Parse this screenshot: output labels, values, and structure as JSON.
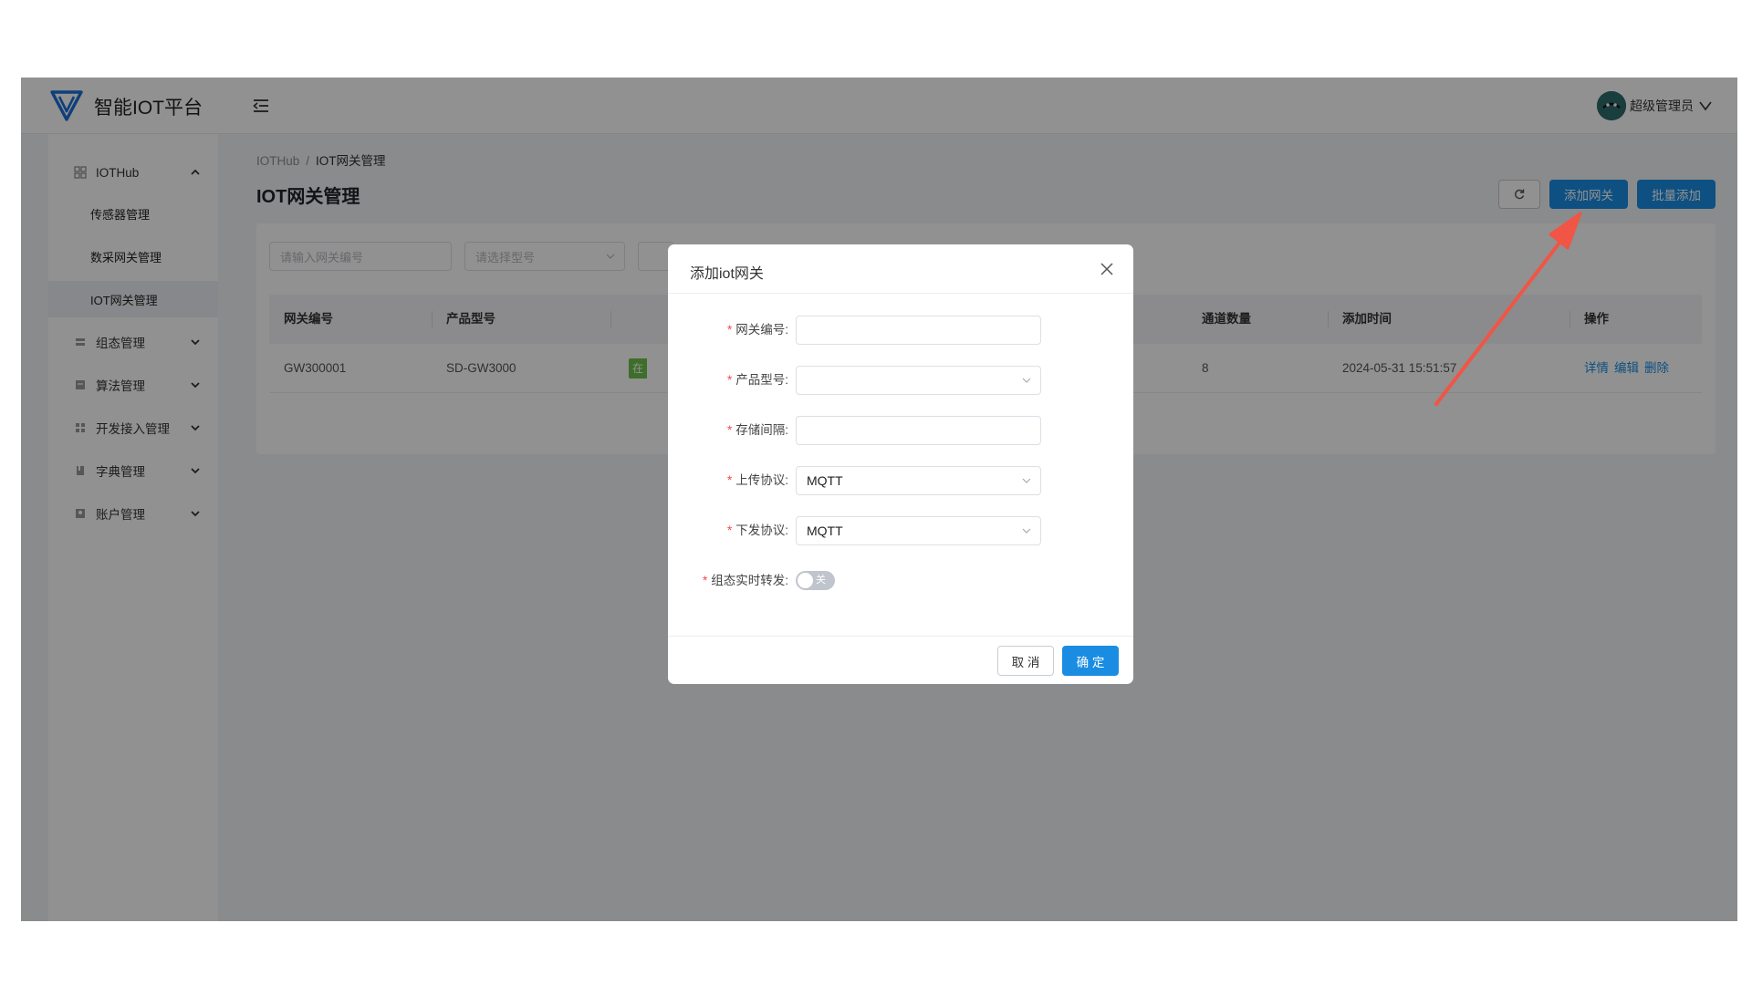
{
  "app": {
    "title": "智能IOT平台"
  },
  "user": {
    "name": "超级管理员"
  },
  "sidebar": {
    "groups": [
      {
        "label": "IOTHub",
        "icon": "grid-icon"
      },
      {
        "label": "组态管理",
        "icon": "layers-icon"
      },
      {
        "label": "算法管理",
        "icon": "list-icon"
      },
      {
        "label": "开发接入管理",
        "icon": "apps-icon"
      },
      {
        "label": "字典管理",
        "icon": "book-icon"
      },
      {
        "label": "账户管理",
        "icon": "user-card-icon"
      }
    ],
    "subitems": [
      {
        "label": "传感器管理"
      },
      {
        "label": "数采网关管理"
      },
      {
        "label": "IOT网关管理"
      }
    ]
  },
  "breadcrumb": {
    "parent": "IOTHub",
    "sep": "/",
    "current": "IOT网关管理"
  },
  "page": {
    "title": "IOT网关管理"
  },
  "toolbar": {
    "add_label": "添加网关",
    "batch_add_label": "批量添加"
  },
  "filters": {
    "gateway_placeholder": "请输入网关编号",
    "model_placeholder": "请选择型号"
  },
  "table": {
    "columns": [
      "网关编号",
      "产品型号",
      "通道数量",
      "添加时间",
      "操作"
    ],
    "rows": [
      {
        "gateway_no": "GW300001",
        "model": "SD-GW3000",
        "status": "在",
        "channels": "8",
        "added": "2024-05-31 15:51:57",
        "actions": [
          "详情",
          "编辑",
          "删除"
        ]
      }
    ]
  },
  "modal": {
    "title": "添加iot网关",
    "fields": [
      {
        "label": "网关编号:",
        "value": ""
      },
      {
        "label": "产品型号:",
        "value": ""
      },
      {
        "label": "存储间隔:",
        "value": ""
      },
      {
        "label": "上传协议:",
        "value": "MQTT"
      },
      {
        "label": "下发协议:",
        "value": "MQTT"
      },
      {
        "label": "组态实时转发:",
        "switch_text": "关"
      }
    ],
    "required_mark": "*",
    "cancel_label": "取 消",
    "confirm_label": "确 定"
  },
  "colors": {
    "primary": "#1a8de3",
    "success": "#6cc24a",
    "required": "#f24a4a",
    "annotation_arrow": "#f05545"
  }
}
